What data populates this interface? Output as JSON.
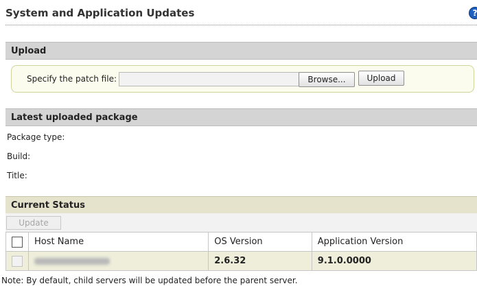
{
  "header": {
    "title": "System and Application Updates",
    "help_glyph": "?"
  },
  "upload": {
    "section_title": "Upload",
    "patch_label": "Specify the patch file:",
    "file_value": "",
    "browse_label": "Browse...",
    "upload_label": "Upload"
  },
  "latest": {
    "section_title": "Latest uploaded package",
    "package_type_label": "Package type:",
    "build_label": "Build:",
    "title_label": "Title:"
  },
  "status": {
    "section_title": "Current Status",
    "update_label": "Update",
    "columns": {
      "host": "Host Name",
      "os": "OS Version",
      "app": "Application Version"
    },
    "rows": [
      {
        "host": "",
        "os": "2.6.32",
        "app": "9.1.0.0000"
      }
    ]
  },
  "note": "Note: By default, child servers will be updated before the parent server.",
  "colors": {
    "section_bar": "#d4d4d4",
    "status_bar": "#e6e3cd",
    "data_row": "#eeeedb",
    "help_icon": "#1f5fbf"
  },
  "icons": {
    "help": "help-icon"
  }
}
